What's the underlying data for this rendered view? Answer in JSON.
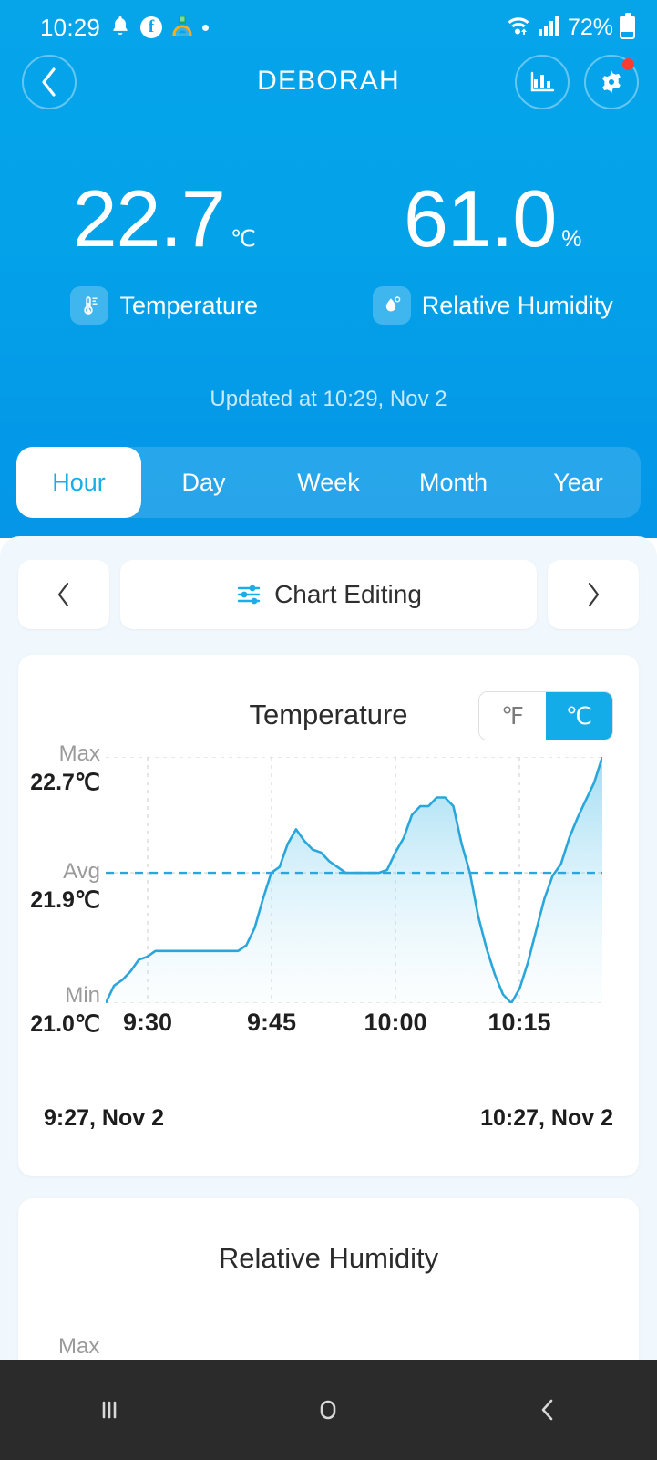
{
  "status_bar": {
    "time": "10:29",
    "battery_percent": "72%",
    "icons": [
      "bell-icon",
      "facebook-icon",
      "app-icon",
      "dot-icon",
      "wifi-icon",
      "cellular-signal-icon",
      "battery-icon"
    ]
  },
  "app_bar": {
    "title": "DEBORAH",
    "back_icon": "chevron-left-icon",
    "chart_icon": "bar-chart-icon",
    "settings_icon": "gear-icon",
    "settings_badge": true
  },
  "readings": [
    {
      "value": "22.7",
      "unit": "℃",
      "label": "Temperature",
      "icon": "thermometer-icon"
    },
    {
      "value": "61.0",
      "unit": "%",
      "label": "Relative Humidity",
      "icon": "humidity-drop-icon"
    }
  ],
  "updated_text": "Updated at 10:29, Nov 2",
  "tabs": [
    {
      "label": "Hour",
      "active": true
    },
    {
      "label": "Day",
      "active": false
    },
    {
      "label": "Week",
      "active": false
    },
    {
      "label": "Month",
      "active": false
    },
    {
      "label": "Year",
      "active": false
    }
  ],
  "nav_row": {
    "prev_icon": "chevron-left-icon",
    "next_icon": "chevron-right-icon",
    "edit_label": "Chart Editing",
    "edit_icon": "sliders-icon"
  },
  "temperature_card": {
    "title": "Temperature",
    "unit_toggle": {
      "options": [
        "℉",
        "℃"
      ],
      "selected": "℃"
    },
    "axis_labels": [
      {
        "name": "Max",
        "value": "22.7℃"
      },
      {
        "name": "Avg",
        "value": "21.9℃"
      },
      {
        "name": "Min",
        "value": "21.0℃"
      }
    ],
    "range_start": "9:27, Nov 2",
    "range_end": "10:27, Nov 2"
  },
  "humidity_card": {
    "title": "Relative Humidity",
    "axis_labels": [
      {
        "name": "Max",
        "value": ""
      }
    ]
  },
  "colors": {
    "header_blue": "#03A2E9",
    "accent": "#13ACE8",
    "page_bg": "#F1F8FD",
    "card_bg": "#FFFFFF",
    "badge_red": "#FF3B30",
    "line": "#2BA6DB"
  },
  "android_nav": {
    "recents_icon": "recents-icon",
    "home_icon": "home-icon",
    "back_icon": "back-icon"
  },
  "chart_data": {
    "type": "area",
    "title": "Temperature",
    "xlabel": "",
    "ylabel": "℃",
    "ylim": [
      21.0,
      22.7
    ],
    "xlim": [
      "9:27",
      "10:27"
    ],
    "grid": true,
    "gridlines_y": [
      22.7,
      21.9,
      21.0
    ],
    "avg_line": 21.9,
    "xticks": [
      "9:30",
      "9:45",
      "10:00",
      "10:15"
    ],
    "yticks": [
      {
        "name": "Max",
        "value": 22.7
      },
      {
        "name": "Avg",
        "value": 21.9
      },
      {
        "name": "Min",
        "value": 21.0
      }
    ],
    "series": [
      {
        "name": "Temperature",
        "unit": "℃",
        "x": [
          "9:27",
          "9:28",
          "9:29",
          "9:30",
          "9:31",
          "9:32",
          "9:33",
          "9:34",
          "9:35",
          "9:36",
          "9:37",
          "9:38",
          "9:39",
          "9:40",
          "9:41",
          "9:42",
          "9:43",
          "9:44",
          "9:45",
          "9:46",
          "9:47",
          "9:48",
          "9:49",
          "9:50",
          "9:51",
          "9:52",
          "9:53",
          "9:54",
          "9:55",
          "9:56",
          "9:57",
          "9:58",
          "9:59",
          "10:00",
          "10:01",
          "10:02",
          "10:03",
          "10:04",
          "10:05",
          "10:06",
          "10:07",
          "10:08",
          "10:09",
          "10:10",
          "10:11",
          "10:12",
          "10:13",
          "10:14",
          "10:15",
          "10:16",
          "10:17",
          "10:18",
          "10:19",
          "10:20",
          "10:21",
          "10:22",
          "10:23",
          "10:24",
          "10:25",
          "10:26",
          "10:27"
        ],
        "values": [
          21.0,
          21.12,
          21.16,
          21.22,
          21.3,
          21.32,
          21.36,
          21.36,
          21.36,
          21.36,
          21.36,
          21.36,
          21.36,
          21.36,
          21.36,
          21.36,
          21.36,
          21.4,
          21.52,
          21.72,
          21.9,
          21.94,
          22.1,
          22.2,
          22.12,
          22.06,
          22.04,
          21.98,
          21.94,
          21.9,
          21.9,
          21.9,
          21.9,
          21.9,
          21.92,
          22.04,
          22.14,
          22.3,
          22.36,
          22.36,
          22.42,
          22.42,
          22.36,
          22.1,
          21.9,
          21.6,
          21.38,
          21.2,
          21.06,
          21.0,
          21.1,
          21.28,
          21.5,
          21.72,
          21.88,
          21.96,
          22.14,
          22.28,
          22.4,
          22.52,
          22.7
        ]
      }
    ]
  }
}
